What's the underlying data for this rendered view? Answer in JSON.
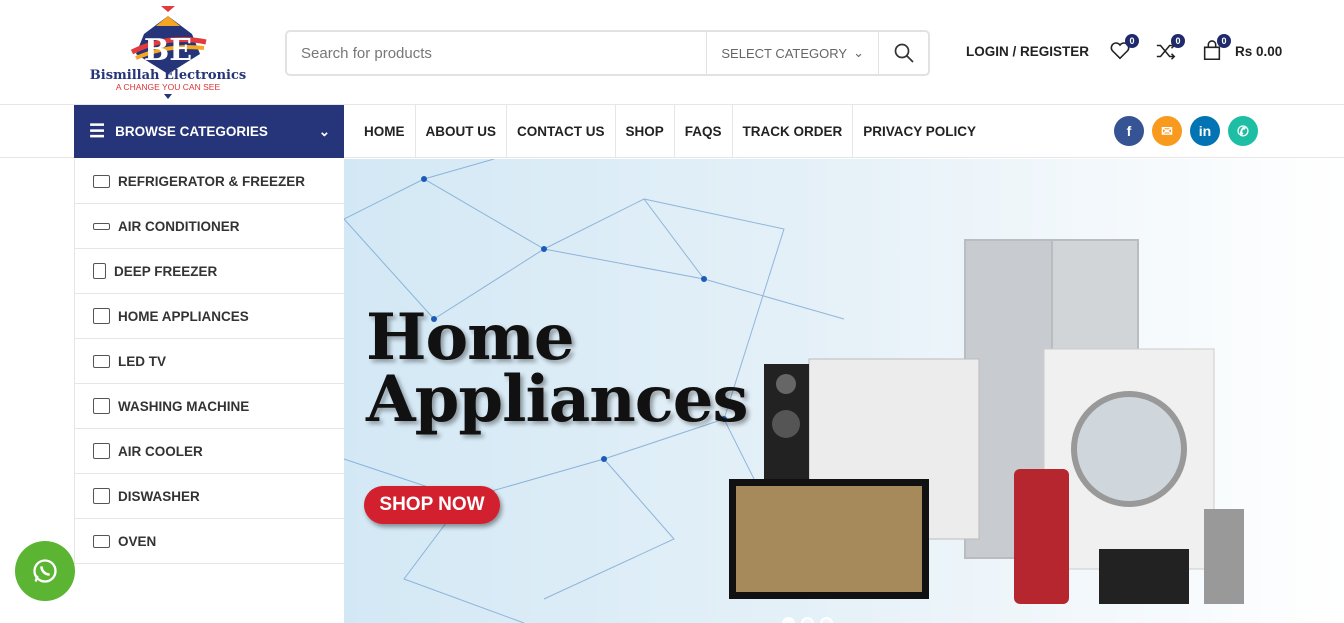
{
  "brand": {
    "name": "Bismillah Electronics",
    "tagline": "A CHANGE YOU CAN SEE"
  },
  "search": {
    "placeholder": "Search for products",
    "category": "SELECT CATEGORY"
  },
  "header": {
    "login": "LOGIN / REGISTER",
    "wishlist_count": "0",
    "compare_count": "0",
    "cart_count": "0",
    "cart_total": "Rs 0.00"
  },
  "nav": {
    "browse": "BROWSE CATEGORIES",
    "menu": [
      "HOME",
      "ABOUT US",
      "CONTACT US",
      "SHOP",
      "FAQS",
      "TRACK ORDER",
      "PRIVACY POLICY"
    ]
  },
  "social": [
    {
      "icon": "facebook-icon",
      "color": "#365493"
    },
    {
      "icon": "email-icon",
      "color": "#f89a1e"
    },
    {
      "icon": "linkedin-icon",
      "color": "#0274b3"
    },
    {
      "icon": "whatsapp-icon",
      "color": "#1ebea5"
    }
  ],
  "categories": [
    "REFRIGERATOR & FREEZER",
    "AIR CONDITIONER",
    "DEEP FREEZER",
    "HOME APPLIANCES",
    "LED TV",
    "WASHING MACHINE",
    "AIR COOLER",
    "DISWASHER",
    "OVEN"
  ],
  "banner": {
    "line1": "Home",
    "line2": "Appliances",
    "button": "SHOP NOW",
    "slides": 3,
    "active_slide": 1
  }
}
